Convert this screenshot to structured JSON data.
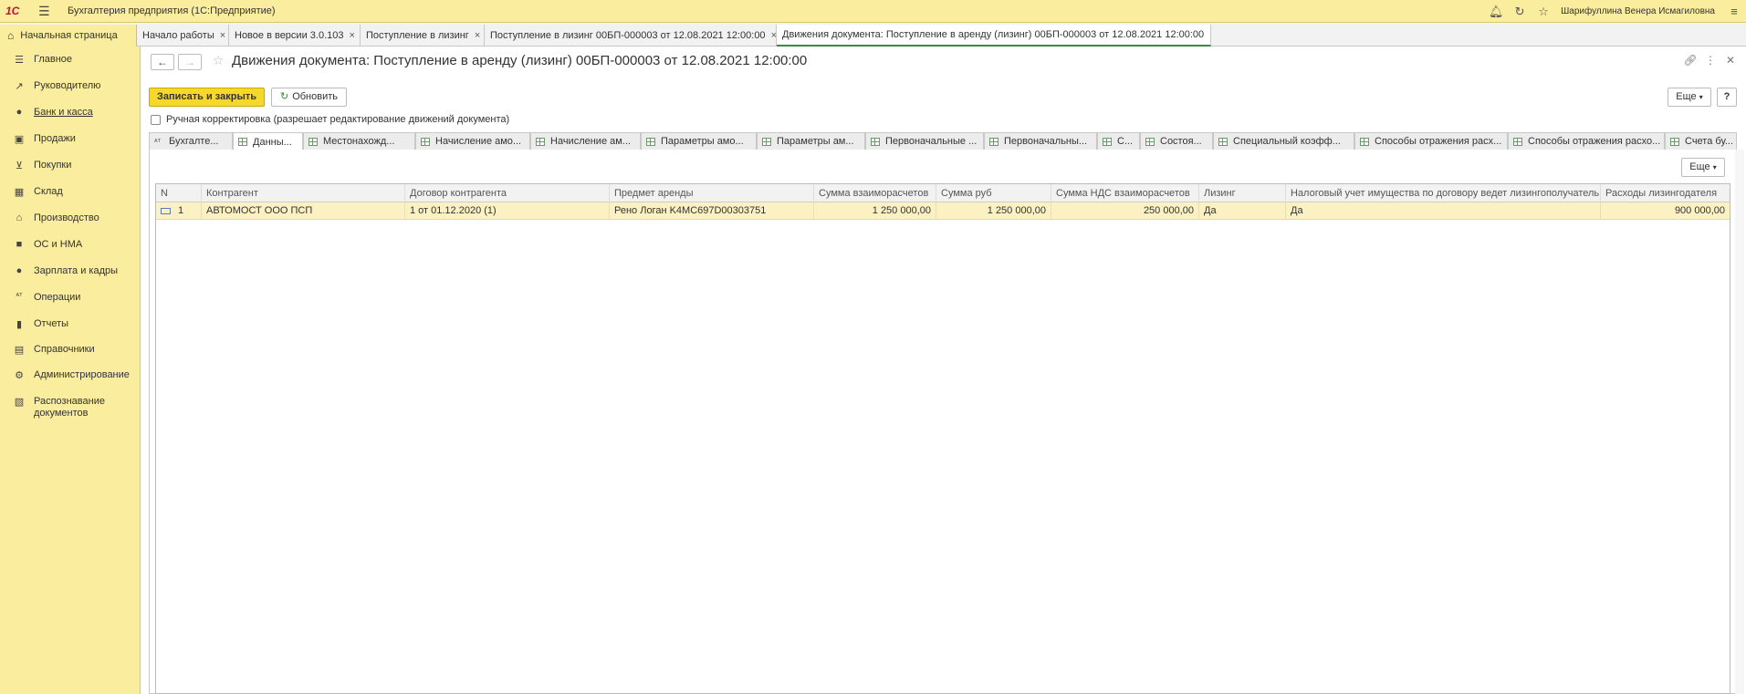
{
  "app": {
    "logo": "1С",
    "title": "Бухгалтерия предприятия  (1С:Предприятие)",
    "user": "Шарифуллина Венера Исмагиловна"
  },
  "open_tabs": [
    {
      "label": "Начальная страница"
    },
    {
      "label": "Начало работы"
    },
    {
      "label": "Новое в версии 3.0.103"
    },
    {
      "label": "Поступление в лизинг"
    },
    {
      "label": "Поступление в лизинг 00БП-000003 от 12.08.2021 12:00:00"
    },
    {
      "label": "Движения документа: Поступление в аренду (лизинг) 00БП-000003 от 12.08.2021 12:00:00"
    }
  ],
  "sidebar": {
    "items": [
      {
        "label": "Главное",
        "icon": "list-icon"
      },
      {
        "label": "Руководителю",
        "icon": "trend-icon"
      },
      {
        "label": "Банк и касса",
        "icon": "coin-icon"
      },
      {
        "label": "Продажи",
        "icon": "bag-icon"
      },
      {
        "label": "Покупки",
        "icon": "cart-icon"
      },
      {
        "label": "Склад",
        "icon": "warehouse-icon"
      },
      {
        "label": "Производство",
        "icon": "factory-icon"
      },
      {
        "label": "ОС и НМА",
        "icon": "truck-icon"
      },
      {
        "label": "Зарплата и кадры",
        "icon": "person-icon"
      },
      {
        "label": "Операции",
        "icon": "operations-icon"
      },
      {
        "label": "Отчеты",
        "icon": "bar-chart-icon"
      },
      {
        "label": "Справочники",
        "icon": "book-icon"
      },
      {
        "label": "Администрирование",
        "icon": "gear-icon"
      },
      {
        "label": "Распознавание документов",
        "icon": "scan-icon"
      }
    ]
  },
  "document": {
    "title": "Движения документа: Поступление в аренду (лизинг) 00БП-000003 от 12.08.2021 12:00:00",
    "save_close": "Записать и закрыть",
    "refresh": "Обновить",
    "more": "Еще",
    "help": "?",
    "manual_edit": "Ручная корректировка (разрешает редактирование движений документа)"
  },
  "inner_tabs": [
    {
      "label": "Бухгалте..."
    },
    {
      "label": "Данны..."
    },
    {
      "label": "Местонахожд..."
    },
    {
      "label": "Начисление амо..."
    },
    {
      "label": "Начисление ам..."
    },
    {
      "label": "Параметры амо..."
    },
    {
      "label": "Параметры ам..."
    },
    {
      "label": "Первоначальные ..."
    },
    {
      "label": "Первоначальны..."
    },
    {
      "label": "С..."
    },
    {
      "label": "Состоя..."
    },
    {
      "label": "Специальный коэфф..."
    },
    {
      "label": "Способы отражения расх..."
    },
    {
      "label": "Способы отражения расхо..."
    },
    {
      "label": "Счета бу..."
    }
  ],
  "grid": {
    "more": "Еще",
    "columns": [
      "N",
      "Контрагент",
      "Договор контрагента",
      "Предмет аренды",
      "Сумма взаиморасчетов",
      "Сумма руб",
      "Сумма НДС взаиморасчетов",
      "Лизинг",
      "Налоговый учет имущества по договору ведет лизингополучатель",
      "Расходы лизингодателя"
    ],
    "rows": [
      [
        "1",
        "АВТОМОСТ ООО ПСП",
        "1 от 01.12.2020 (1)",
        "Рено Логан K4MC697D00303751",
        "1 250 000,00",
        "1 250 000,00",
        "250 000,00",
        "Да",
        "Да",
        "900 000,00"
      ]
    ]
  }
}
